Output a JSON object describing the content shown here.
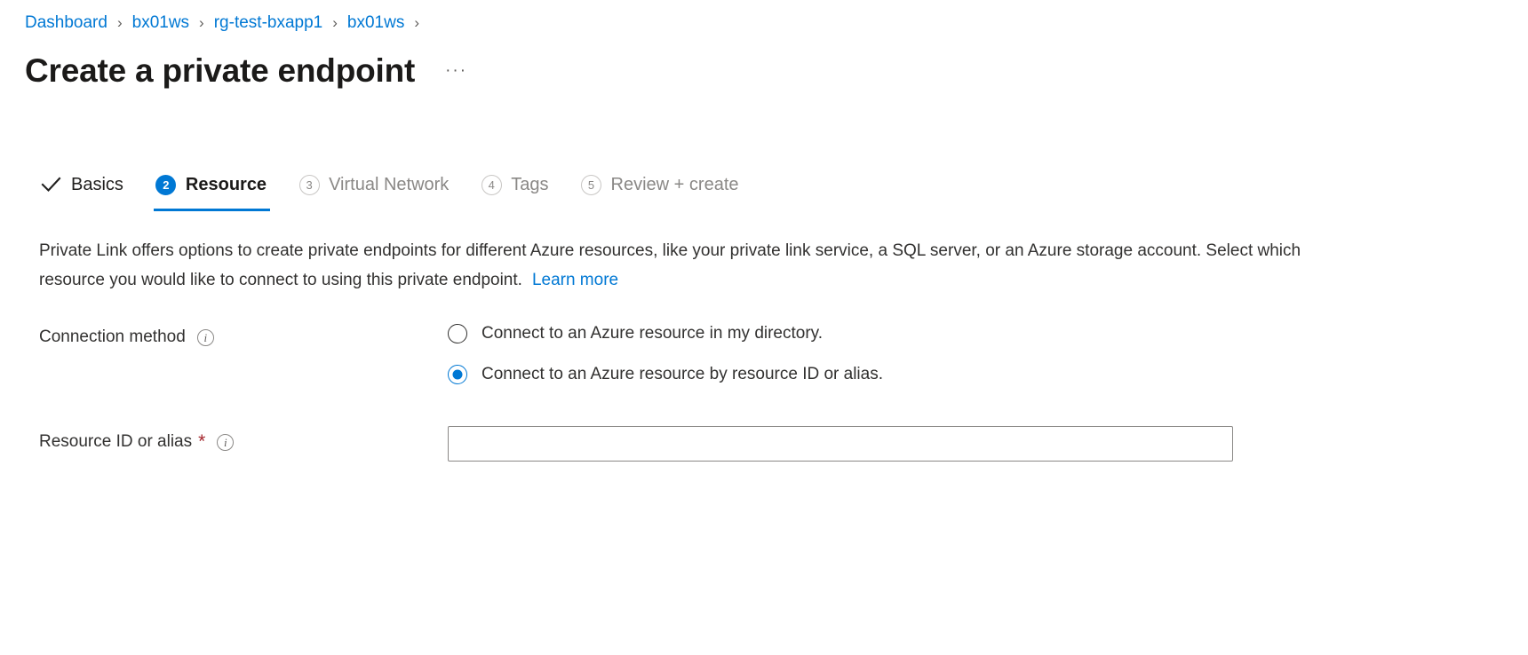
{
  "breadcrumb": {
    "separator": "›",
    "items": [
      {
        "label": "Dashboard"
      },
      {
        "label": "bx01ws"
      },
      {
        "label": "rg-test-bxapp1"
      },
      {
        "label": "bx01ws"
      }
    ]
  },
  "header": {
    "title": "Create a private endpoint",
    "more_label": "···"
  },
  "wizard": {
    "tabs": [
      {
        "label": "Basics",
        "marker": "check",
        "state": "done"
      },
      {
        "label": "Resource",
        "marker": "2",
        "state": "active"
      },
      {
        "label": "Virtual Network",
        "marker": "3",
        "state": "upcoming"
      },
      {
        "label": "Tags",
        "marker": "4",
        "state": "upcoming"
      },
      {
        "label": "Review + create",
        "marker": "5",
        "state": "upcoming"
      }
    ]
  },
  "main": {
    "intro_text": "Private Link offers options to create private endpoints for different Azure resources, like your private link service, a SQL server, or an Azure storage account. Select which resource you would like to connect to using this private endpoint.",
    "learn_more": "Learn more",
    "connection_method": {
      "label": "Connection method",
      "info": "i",
      "options": [
        {
          "label": "Connect to an Azure resource in my directory.",
          "selected": false
        },
        {
          "label": "Connect to an Azure resource by resource ID or alias.",
          "selected": true
        }
      ]
    },
    "resource_id": {
      "label": "Resource ID or alias",
      "required_mark": "*",
      "info": "i",
      "value": "",
      "placeholder": ""
    }
  },
  "colors": {
    "accent": "#0078d4",
    "link": "#0078d4",
    "required": "#a4262c",
    "muted": "#8a8886",
    "text": "#323130"
  }
}
